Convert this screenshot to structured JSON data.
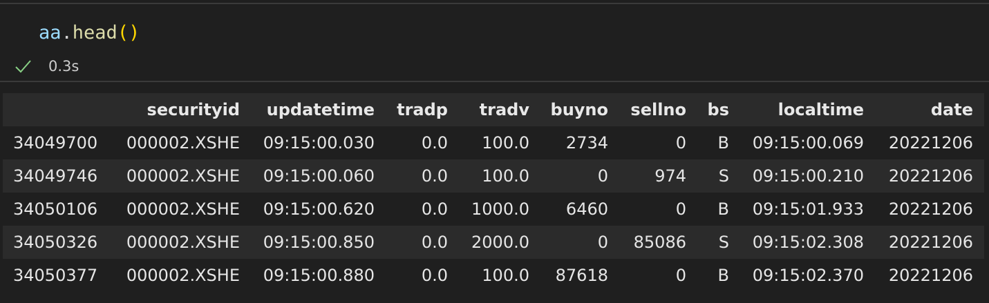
{
  "cell": {
    "code": {
      "var": "aa",
      "dot": ".",
      "method": "head",
      "open_paren": "(",
      "close_paren": ")"
    },
    "status": {
      "icon": "check-icon",
      "time": "0.3s"
    },
    "colors": {
      "background": "#1f1f1f",
      "var": "#9cdcfe",
      "method": "#dcdcaa",
      "paren": "#ffd700",
      "check": "#89d185"
    }
  },
  "table": {
    "columns": [
      "",
      "securityid",
      "updatetime",
      "tradp",
      "tradv",
      "buyno",
      "sellno",
      "bs",
      "localtime",
      "date"
    ],
    "rows": [
      [
        "34049700",
        "000002.XSHE",
        "09:15:00.030",
        "0.0",
        "100.0",
        "2734",
        "0",
        "B",
        "09:15:00.069",
        "20221206"
      ],
      [
        "34049746",
        "000002.XSHE",
        "09:15:00.060",
        "0.0",
        "100.0",
        "0",
        "974",
        "S",
        "09:15:00.210",
        "20221206"
      ],
      [
        "34050106",
        "000002.XSHE",
        "09:15:00.620",
        "0.0",
        "1000.0",
        "6460",
        "0",
        "B",
        "09:15:01.933",
        "20221206"
      ],
      [
        "34050326",
        "000002.XSHE",
        "09:15:00.850",
        "0.0",
        "2000.0",
        "0",
        "85086",
        "S",
        "09:15:02.308",
        "20221206"
      ],
      [
        "34050377",
        "000002.XSHE",
        "09:15:00.880",
        "0.0",
        "100.0",
        "87618",
        "0",
        "B",
        "09:15:02.370",
        "20221206"
      ]
    ]
  }
}
